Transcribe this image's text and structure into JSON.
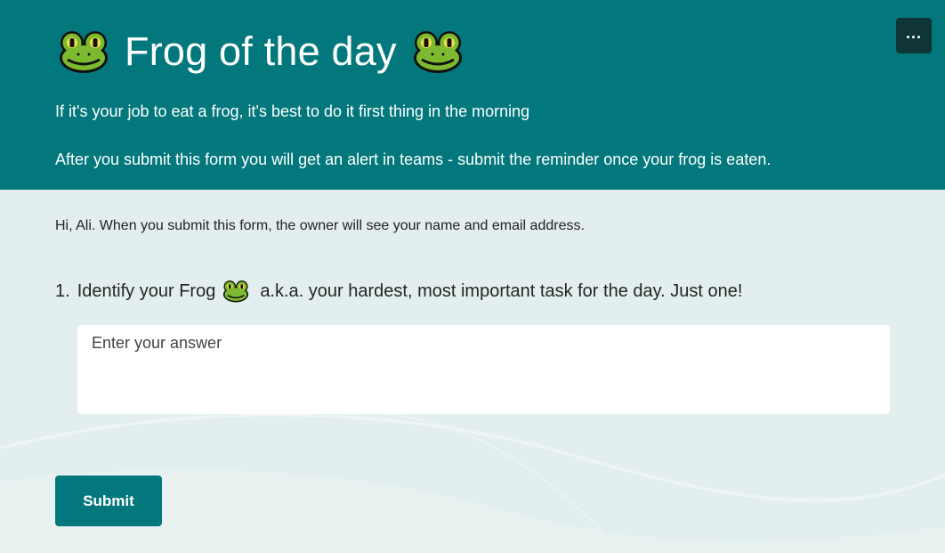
{
  "header": {
    "title": "Frog of the day",
    "title_prefix_icon": "frog-emoji",
    "title_suffix_icon": "frog-emoji",
    "description_line1": "If it's your job to eat a frog, it's best to do it first thing in the morning",
    "description_line2": "After you submit this form you will get an alert in teams - submit the reminder once your frog is eaten.",
    "more_options_icon": "ellipsis-icon",
    "bg_color": "#03787c"
  },
  "form": {
    "notice": "Hi, Ali. When you submit this form, the owner will see your name and email address.",
    "questions": [
      {
        "number": "1.",
        "text_before": "Identify your Frog",
        "icon": "frog-emoji",
        "text_after": "a.k.a. your hardest, most important task for the day. Just one!",
        "placeholder": "Enter your answer",
        "value": ""
      }
    ],
    "submit_label": "Submit"
  },
  "colors": {
    "accent": "#03787c",
    "page_bg": "#e3efee",
    "menu_button": "#0f3536"
  }
}
